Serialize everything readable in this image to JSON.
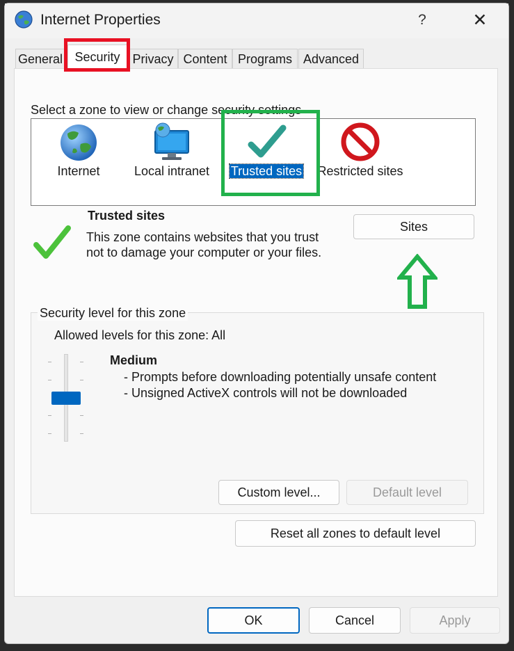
{
  "window": {
    "title": "Internet Properties",
    "help": "?",
    "close": "✕"
  },
  "tabs": [
    {
      "label": "General"
    },
    {
      "label": "Security"
    },
    {
      "label": "Privacy"
    },
    {
      "label": "Content"
    },
    {
      "label": "Programs"
    },
    {
      "label": "Advanced"
    }
  ],
  "zones": {
    "prompt": "Select a zone to view or change security settings",
    "items": [
      {
        "label": "Internet"
      },
      {
        "label": "Local intranet"
      },
      {
        "label": "Trusted sites"
      },
      {
        "label": "Restricted sites"
      }
    ],
    "selected": "Trusted sites"
  },
  "description": {
    "title": "Trusted sites",
    "text": "This zone contains websites that you trust not to damage your computer or your files.",
    "sites_button": "Sites"
  },
  "security_level": {
    "legend": "Security level for this zone",
    "allowed": "Allowed levels for this zone: All",
    "level_name": "Medium",
    "level_fraction": 0.5,
    "details": [
      "- Prompts before downloading potentially unsafe content",
      "- Unsigned ActiveX controls will not be downloaded"
    ],
    "custom_button": "Custom level...",
    "default_button": "Default level"
  },
  "reset_button": "Reset all zones to default level",
  "footer": {
    "ok": "OK",
    "cancel": "Cancel",
    "apply": "Apply"
  },
  "colors": {
    "accent": "#0067c0",
    "annotation_red": "#e81123",
    "annotation_green": "#22b14c"
  }
}
